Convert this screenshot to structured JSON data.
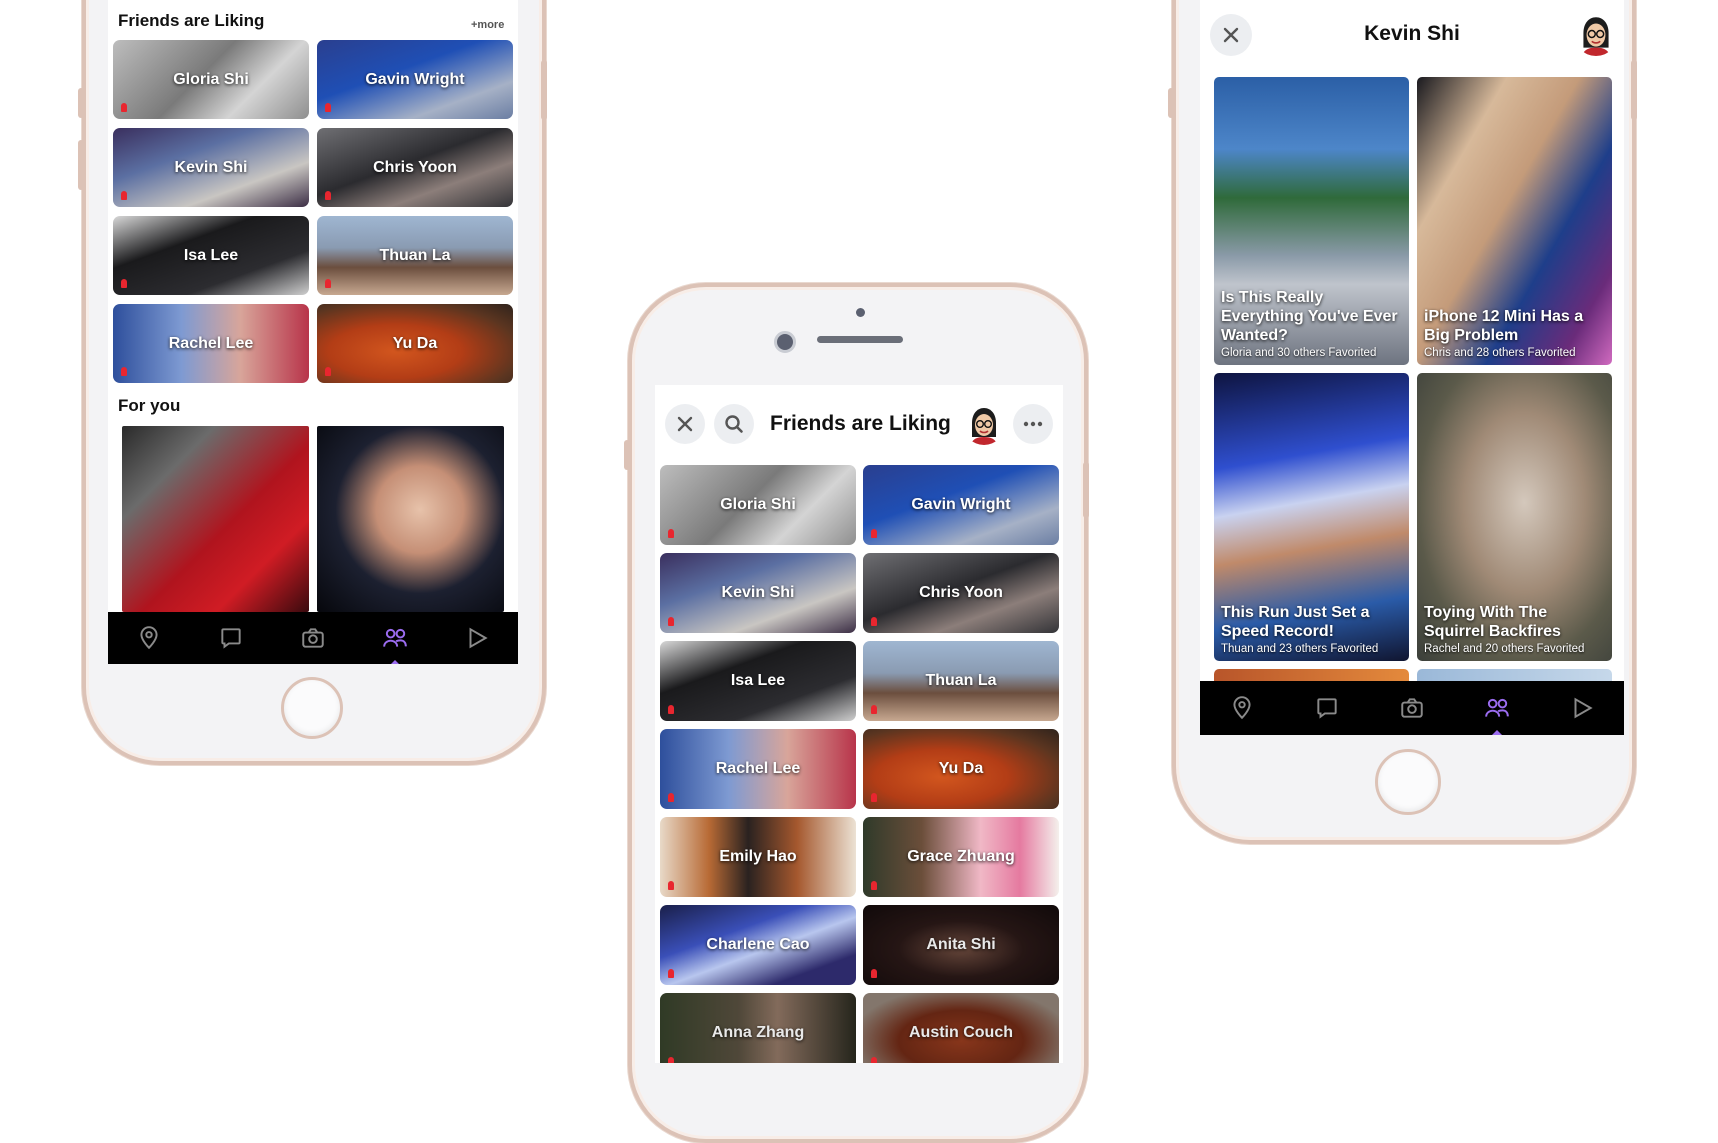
{
  "colors": {
    "frame": "#dcc2b6",
    "accent": "#9b6cf0",
    "pin": "#e8262f"
  },
  "left_phone": {
    "friends_title": "Friends are Liking",
    "more_label": "+more",
    "friends": [
      {
        "name": "Gloria Shi"
      },
      {
        "name": "Gavin Wright"
      },
      {
        "name": "Kevin Shi"
      },
      {
        "name": "Chris Yoon"
      },
      {
        "name": "Isa Lee"
      },
      {
        "name": "Thuan La"
      },
      {
        "name": "Rachel Lee"
      },
      {
        "name": "Yu Da"
      }
    ],
    "for_you_title": "For you",
    "nav": [
      "map-pin-icon",
      "chat-icon",
      "camera-icon",
      "friends-icon",
      "play-icon"
    ],
    "nav_active": "friends-icon"
  },
  "middle_phone": {
    "title": "Friends are Liking",
    "friends": [
      {
        "name": "Gloria Shi"
      },
      {
        "name": "Gavin Wright"
      },
      {
        "name": "Kevin Shi"
      },
      {
        "name": "Chris Yoon"
      },
      {
        "name": "Isa Lee"
      },
      {
        "name": "Thuan La"
      },
      {
        "name": "Rachel Lee"
      },
      {
        "name": "Yu Da"
      },
      {
        "name": "Emily Hao"
      },
      {
        "name": "Grace Zhuang"
      },
      {
        "name": "Charlene Cao"
      },
      {
        "name": "Anita Shi"
      },
      {
        "name": "Anna Zhang"
      },
      {
        "name": "Austin Couch"
      }
    ]
  },
  "right_phone": {
    "title": "Kevin Shi",
    "cards": [
      {
        "title": "Is This Really Everything You've Ever Wanted?",
        "sub": "Gloria and 30 others Favorited"
      },
      {
        "title": "iPhone 12 Mini Has a Big Problem",
        "sub": "Chris and 28 others Favorited"
      },
      {
        "title": "This Run Just Set a Speed Record!",
        "sub": "Thuan and 23 others Favorited"
      },
      {
        "title": "Toying With The Squirrel Backfires",
        "sub": "Rachel and 20 others Favorited"
      }
    ],
    "nav": [
      "map-pin-icon",
      "chat-icon",
      "camera-icon",
      "friends-icon",
      "play-icon"
    ],
    "nav_active": "friends-icon"
  }
}
